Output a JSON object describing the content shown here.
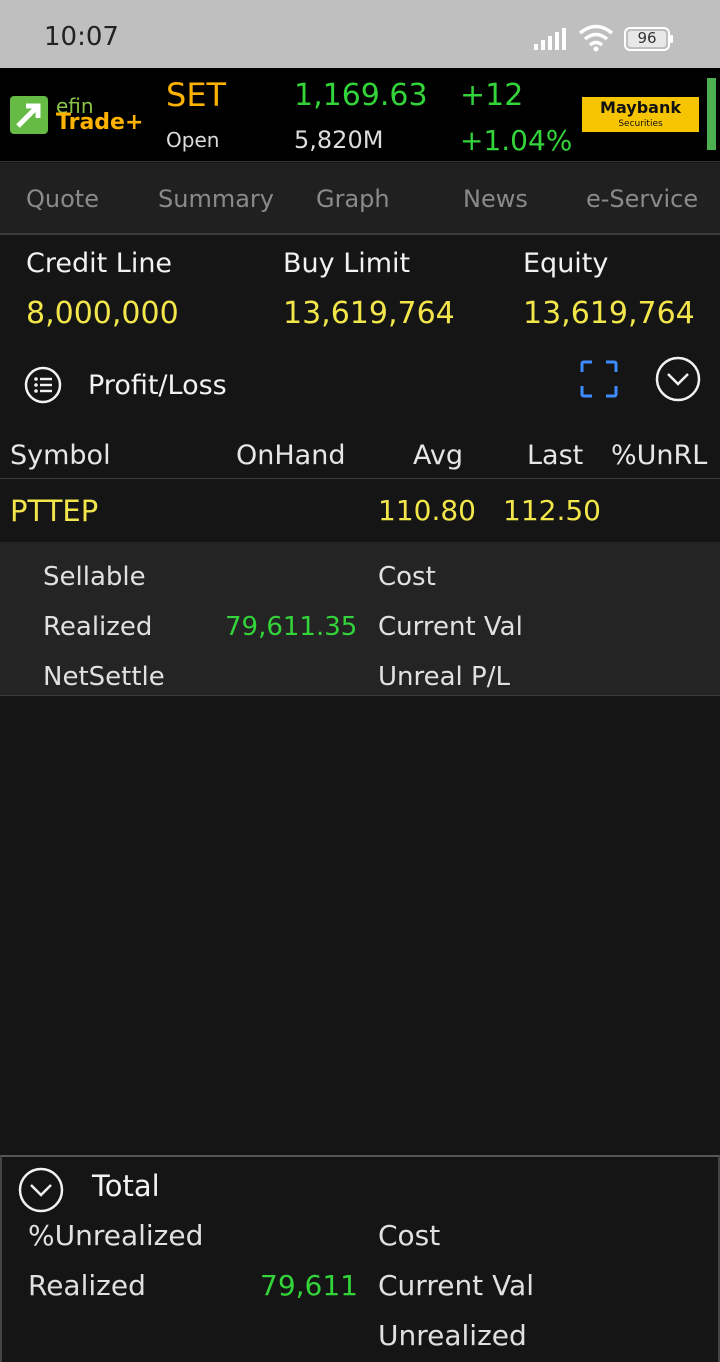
{
  "status_bar": {
    "time": "10:07",
    "battery": "96",
    "icons": [
      "signal-icon",
      "wifi-icon",
      "battery-icon"
    ]
  },
  "header": {
    "logo_top": "efin",
    "logo_bottom": "Trade+",
    "market_name": "SET",
    "market_status": "Open",
    "index_value": "1,169.63",
    "volume": "5,820M",
    "change": "+12",
    "change_pct": "+1.04%",
    "broker_name": "Maybank",
    "broker_sub": "Securities",
    "colors": {
      "up": "#33d33a",
      "accent": "#ffb300",
      "broker": "#f6c400"
    }
  },
  "tabs": [
    {
      "label": "Quote"
    },
    {
      "label": "Summary"
    },
    {
      "label": "Graph"
    },
    {
      "label": "News"
    },
    {
      "label": "e-Service"
    }
  ],
  "account": {
    "credit_line_label": "Credit Line",
    "credit_line_value": "8,000,000",
    "buy_limit_label": "Buy Limit",
    "buy_limit_value": "13,619,764",
    "equity_label": "Equity",
    "equity_value": "13,619,764"
  },
  "section": {
    "title": "Profit/Loss"
  },
  "table": {
    "headers": [
      "Symbol",
      "OnHand",
      "Avg",
      "Last",
      "%UnRL"
    ],
    "rows": [
      {
        "symbol": "PTTEP",
        "onhand": "",
        "avg": "110.80",
        "last": "112.50",
        "unrl": ""
      }
    ]
  },
  "detail": {
    "sellable_label": "Sellable",
    "realized_label": "Realized",
    "realized_value": "79,611.35",
    "netsettle_label": "NetSettle",
    "cost_label": "Cost",
    "current_val_label": "Current Val",
    "unreal_pl_label": "Unreal P/L"
  },
  "total": {
    "title": "Total",
    "unrealized_pct_label": "%Unrealized",
    "realized_label": "Realized",
    "realized_value": "79,611",
    "cost_label": "Cost",
    "current_val_label": "Current Val",
    "unrealized_label": "Unrealized"
  }
}
